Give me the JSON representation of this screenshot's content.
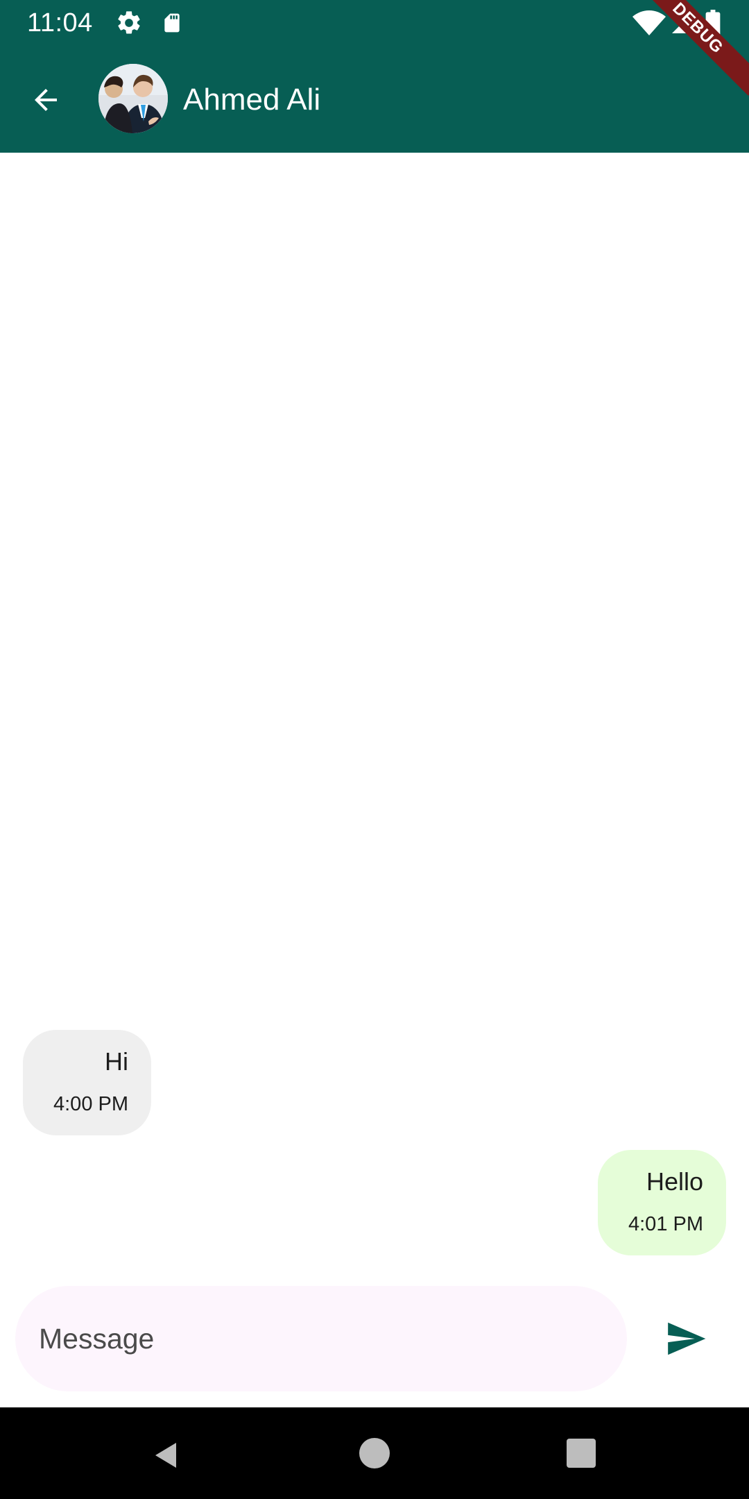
{
  "status_bar": {
    "time": "11:04",
    "icons": [
      "gear-icon",
      "sd-card-icon",
      "wifi-icon",
      "signal-icon",
      "battery-icon"
    ]
  },
  "app_bar": {
    "back_label": "Back",
    "contact_name": "Ahmed Ali",
    "avatar_description": "Contact avatar photo"
  },
  "debug_banner": {
    "label": "DEBUG"
  },
  "messages": [
    {
      "direction": "incoming",
      "text": "Hi",
      "time": "4:00 PM"
    },
    {
      "direction": "outgoing",
      "text": "Hello",
      "time": "4:01 PM"
    }
  ],
  "composer": {
    "placeholder": "Message",
    "value": ""
  },
  "colors": {
    "primary": "#075E54",
    "incoming_bubble": "#EFEFEF",
    "outgoing_bubble": "#E5FDD8",
    "input_background": "#FDF5FD",
    "debug_banner": "#7B1A1A"
  }
}
